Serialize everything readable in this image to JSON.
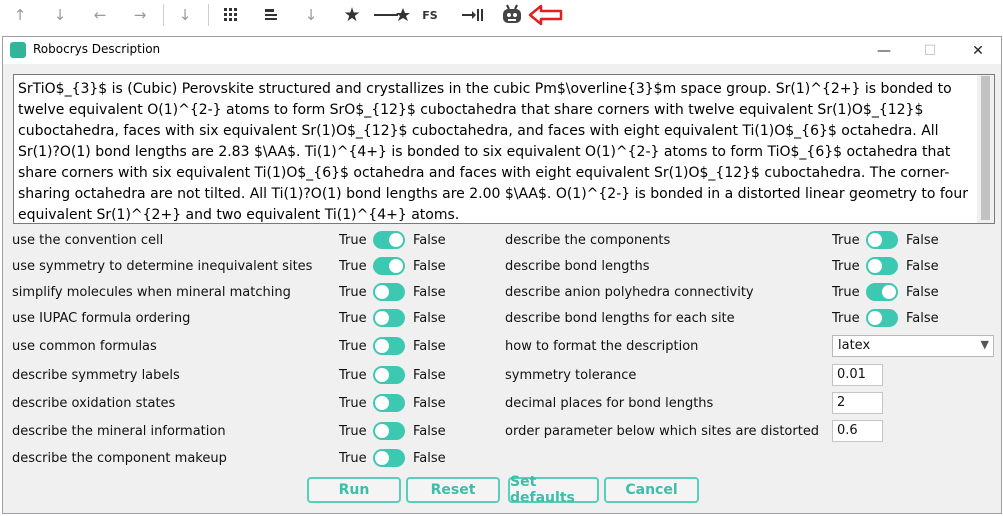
{
  "toolbar": {
    "icons": [
      "arrow-up-icon",
      "arrow-down-icon",
      "arrow-left-icon",
      "arrow-right-icon",
      "arrow-down-to-line-icon",
      "grid-icon",
      "align-icon",
      "arrow-down-thin-icon",
      "star-icon",
      "arrow-star-icon",
      "fs-icon",
      "import-icon",
      "robot-icon",
      "red-arrow-icon"
    ],
    "fs_label": "FS",
    "accent_red": "#e02020"
  },
  "window": {
    "title": "Robocrys Description",
    "minimize": "—",
    "maximize": "☐",
    "close": "✕"
  },
  "description": "SrTiO$_{3}$ is (Cubic) Perovskite structured and crystallizes in the cubic Pm$\\overline{3}$m space group. Sr(1)^{2+} is bonded to twelve equivalent O(1)^{2-} atoms to form SrO$_{12}$ cuboctahedra that share corners with twelve equivalent Sr(1)O$_{12}$ cuboctahedra, faces with six equivalent Sr(1)O$_{12}$ cuboctahedra, and faces with eight equivalent Ti(1)O$_{6}$ octahedra. All Sr(1)?O(1) bond lengths are 2.83 $\\AA$. Ti(1)^{4+} is bonded to six equivalent O(1)^{2-} atoms to form TiO$_{6}$ octahedra that share corners with six equivalent Ti(1)O$_{6}$ octahedra and faces with eight equivalent Sr(1)O$_{12}$ cuboctahedra. The corner-sharing octahedra are not tilted. All Ti(1)?O(1) bond lengths are 2.00 $\\AA$. O(1)^{2-} is bonded in a distorted linear geometry to four equivalent Sr(1)^{2+} and two equivalent Ti(1)^{4+} atoms.",
  "options_left": [
    {
      "label": "use the convention cell",
      "true": "True",
      "false": "False",
      "state": "true"
    },
    {
      "label": "use symmetry to determine inequivalent sites",
      "true": "True",
      "false": "False",
      "state": "true"
    },
    {
      "label": "simplify molecules when mineral matching",
      "true": "True",
      "false": "False",
      "state": "false"
    },
    {
      "label": "use IUPAC formula ordering",
      "true": "True",
      "false": "False",
      "state": "false"
    },
    {
      "label": "use common formulas",
      "true": "True",
      "false": "False",
      "state": "false"
    },
    {
      "label": "describe symmetry labels",
      "true": "True",
      "false": "False",
      "state": "false"
    },
    {
      "label": "describe oxidation states",
      "true": "True",
      "false": "False",
      "state": "false"
    },
    {
      "label": "describe the mineral information",
      "true": "True",
      "false": "False",
      "state": "false"
    },
    {
      "label": "describe the component makeup",
      "true": "True",
      "false": "False",
      "state": "false"
    }
  ],
  "options_right": [
    {
      "label": "describe the components",
      "true": "True",
      "false": "False",
      "state": "false"
    },
    {
      "label": "describe bond lengths",
      "true": "True",
      "false": "False",
      "state": "false"
    },
    {
      "label": "describe anion polyhedra connectivity",
      "true": "True",
      "false": "False",
      "state": "true"
    },
    {
      "label": "describe bond lengths for each site",
      "true": "True",
      "false": "False",
      "state": "false"
    }
  ],
  "format": {
    "label": "how to format the description",
    "value": "latex"
  },
  "symmetry_tolerance": {
    "label": "symmetry tolerance",
    "value": "0.01"
  },
  "decimal_places": {
    "label": "decimal places for bond lengths",
    "value": "2"
  },
  "order_parameter": {
    "label": "order parameter below which sites are distorted",
    "value": "0.6"
  },
  "buttons": {
    "run": "Run",
    "reset": "Reset",
    "set_defaults": "Set defaults",
    "cancel": "Cancel"
  },
  "colors": {
    "accent": "#3dc9b1",
    "button_text": "#3cbfa8"
  }
}
